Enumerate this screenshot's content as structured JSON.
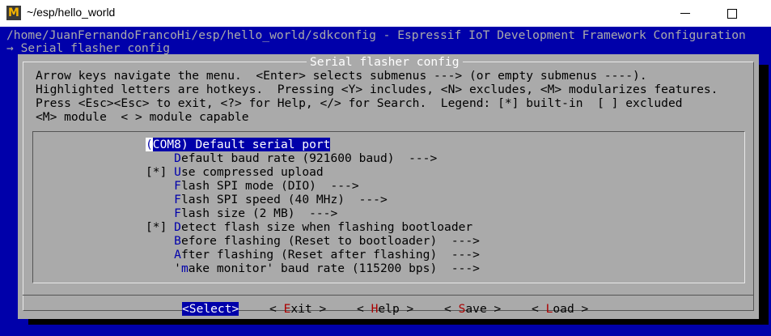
{
  "window": {
    "title": "~/esp/hello_world",
    "icon": "terminal-app-icon",
    "icon_glyph": "M"
  },
  "header": {
    "path_line": "/home/JuanFernandoFrancoHi/esp/hello_world/sdkconfig - Espressif IoT Development Framework Configuration",
    "breadcrumb": "→ Serial flasher config"
  },
  "dialog": {
    "title": "Serial flasher config",
    "help_lines": [
      "Arrow keys navigate the menu.  <Enter> selects submenus ---> (or empty submenus ----).",
      "Highlighted letters are hotkeys.  Pressing <Y> includes, <N> excludes, <M> modularizes features.",
      "Press <Esc><Esc> to exit, <?> for Help, </> for Search.  Legend: [*] built-in  [ ] excluded",
      "<M> module  < > module capable"
    ]
  },
  "menu": {
    "items": [
      {
        "pre": "",
        "hot": "",
        "rest": "(COM8) Default serial port",
        "selected": true
      },
      {
        "pre": "    ",
        "hot": "D",
        "rest": "efault baud rate (921600 baud)  --->"
      },
      {
        "pre": "[*] ",
        "hot": "U",
        "rest": "se compressed upload"
      },
      {
        "pre": "    ",
        "hot": "F",
        "rest": "lash SPI mode (DIO)  --->"
      },
      {
        "pre": "    ",
        "hot": "F",
        "rest": "lash SPI speed (40 MHz)  --->"
      },
      {
        "pre": "    ",
        "hot": "F",
        "rest": "lash size (2 MB)  --->"
      },
      {
        "pre": "[*] ",
        "hot": "D",
        "rest": "etect flash size when flashing bootloader"
      },
      {
        "pre": "    ",
        "hot": "B",
        "rest": "efore flashing (Reset to bootloader)  --->"
      },
      {
        "pre": "    ",
        "hot": "A",
        "rest": "fter flashing (Reset after flashing)  --->"
      },
      {
        "pre": "    '",
        "hot": "m",
        "rest": "ake monitor' baud rate (115200 bps)  --->"
      }
    ]
  },
  "buttons": {
    "select": "<Select>",
    "exit": {
      "pre": "< ",
      "hot": "E",
      "rest": "xit >"
    },
    "help": {
      "pre": "< ",
      "hot": "H",
      "rest": "elp >"
    },
    "save": {
      "pre": "< ",
      "hot": "S",
      "rest": "ave >"
    },
    "load": {
      "pre": "< ",
      "hot": "L",
      "rest": "oad >"
    }
  },
  "colors": {
    "terminal_bg": "#0000aa",
    "dialog_bg": "#aaaaaa",
    "highlight_bg": "#0000aa",
    "hotkey_menu": "#0000aa",
    "hotkey_button": "#aa0000"
  }
}
